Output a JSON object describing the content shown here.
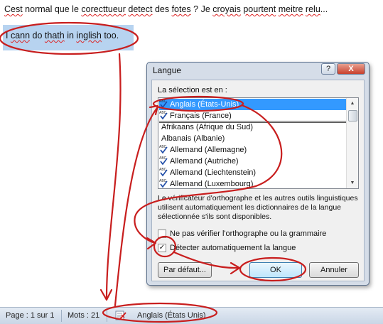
{
  "document": {
    "line1": [
      {
        "t": "Cest",
        "err": true
      },
      {
        "t": " normal que le ",
        "err": false
      },
      {
        "t": "corecttueur",
        "err": true
      },
      {
        "t": " ",
        "err": false
      },
      {
        "t": "detect",
        "err": true
      },
      {
        "t": " des ",
        "err": false
      },
      {
        "t": "fotes",
        "err": true
      },
      {
        "t": " ? Je ",
        "err": false
      },
      {
        "t": "croyais",
        "err": true
      },
      {
        "t": " ",
        "err": false
      },
      {
        "t": "pourtent",
        "err": true
      },
      {
        "t": " ",
        "err": false
      },
      {
        "t": "meitre",
        "err": true
      },
      {
        "t": " ",
        "err": false
      },
      {
        "t": "relu",
        "err": true
      },
      {
        "t": "...",
        "err": false
      }
    ],
    "selected": [
      {
        "t": "I ",
        "err": false
      },
      {
        "t": "cann",
        "err": true
      },
      {
        "t": " do ",
        "err": false
      },
      {
        "t": "thath",
        "err": true
      },
      {
        "t": " in ",
        "err": false
      },
      {
        "t": "inglish",
        "err": true
      },
      {
        "t": " too.",
        "err": false
      }
    ]
  },
  "dialog": {
    "title": "Langue",
    "help_label": "?",
    "close_label": "X",
    "list_label": "La sélection est en :",
    "languages": [
      {
        "label": "Anglais (États-Unis)",
        "spell": true,
        "selected": true
      },
      {
        "label": "Français (France)",
        "spell": true,
        "selected": false
      },
      {
        "label": "Afrikaans (Afrique du Sud)",
        "spell": false,
        "selected": false
      },
      {
        "label": "Albanais (Albanie)",
        "spell": false,
        "selected": false
      },
      {
        "label": "Allemand (Allemagne)",
        "spell": true,
        "selected": false
      },
      {
        "label": "Allemand (Autriche)",
        "spell": true,
        "selected": false
      },
      {
        "label": "Allemand (Liechtenstein)",
        "spell": true,
        "selected": false
      },
      {
        "label": "Allemand (Luxembourg)",
        "spell": true,
        "selected": false
      }
    ],
    "description": "Le vérificateur d'orthographe et les autres outils linguistiques utilisent automatiquement les dictionnaires de la langue sélectionnée s'ils sont disponibles.",
    "no_check_label": "Ne pas vérifier l'orthographe ou la grammaire",
    "no_check_checked": false,
    "auto_detect_label": "Détecter automatiquement la langue",
    "auto_detect_checked": true,
    "default_button": "Par défaut...",
    "ok_button": "OK",
    "cancel_button": "Annuler"
  },
  "statusbar": {
    "page": "Page : 1 sur 1",
    "words": "Mots : 21",
    "language": "Anglais (États Unis)"
  },
  "colors": {
    "annotation": "#c81e1e",
    "selection": "#3399ff",
    "text_highlight": "#b7d3f0"
  }
}
